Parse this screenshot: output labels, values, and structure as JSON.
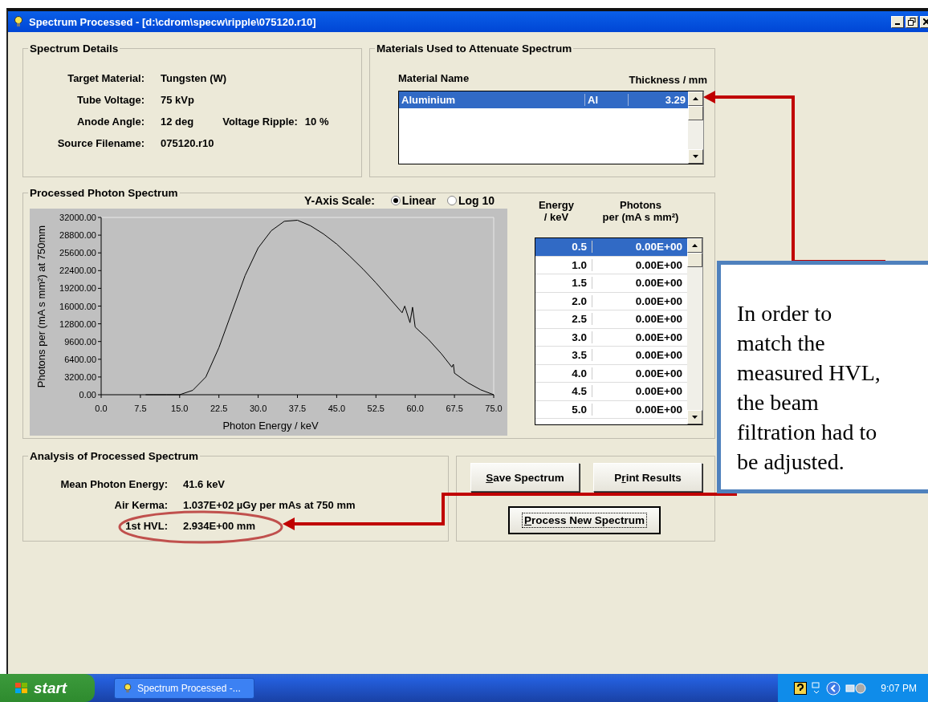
{
  "window": {
    "title": "Spectrum Processed - [d:\\cdrom\\specw\\ripple\\075120.r10]"
  },
  "spectrum_details": {
    "title": "Spectrum Details",
    "fields": [
      {
        "label": "Target Material:",
        "value": "Tungsten (W)"
      },
      {
        "label": "Tube Voltage:",
        "value": "75 kVp"
      },
      {
        "label": "Anode Angle:",
        "value": "12 deg",
        "extra_label": "Voltage Ripple:",
        "extra_value": "10 %"
      },
      {
        "label": "Source Filename:",
        "value": "075120.r10"
      }
    ]
  },
  "materials": {
    "title": "Materials Used to Attenuate Spectrum",
    "columns": [
      "Material Name",
      "Thickness / mm"
    ],
    "rows": [
      {
        "name": "Aluminium",
        "symbol": "Al",
        "thickness": "3.29",
        "selected": true
      }
    ]
  },
  "spectrum": {
    "title": "Processed Photon Spectrum",
    "scale_label": "Y-Axis Scale:",
    "scale_options": [
      {
        "label": "Linear",
        "selected": true
      },
      {
        "label": "Log 10",
        "selected": false
      }
    ],
    "chart_data": {
      "type": "line",
      "xlabel": "Photon Energy / keV",
      "ylabel": "Photons per (mA s mm²) at 750mm",
      "x": [
        8.5,
        10,
        12.5,
        15,
        17.5,
        20,
        22.5,
        25,
        27.5,
        30,
        32.5,
        35,
        37.5,
        40,
        42.5,
        45,
        47.5,
        50,
        52.5,
        55,
        57.5,
        58,
        59,
        59.5,
        60,
        62.5,
        65,
        67,
        67.3,
        67.5,
        70,
        72.5,
        75
      ],
      "series": [
        {
          "color": "#000000",
          "values": [
            0,
            0,
            0,
            0,
            800,
            3200,
            8500,
            15000,
            21500,
            26500,
            29600,
            31300,
            31500,
            30500,
            29000,
            27200,
            25000,
            22700,
            20200,
            17500,
            14800,
            16000,
            13000,
            15800,
            12200,
            10000,
            7400,
            5000,
            5500,
            3900,
            2200,
            900,
            0
          ]
        }
      ],
      "xlim": [
        0,
        75
      ],
      "ylim": [
        0,
        32000
      ],
      "xticks": [
        {
          "value": 0,
          "label": "0.0"
        },
        {
          "value": 7.5,
          "label": "7.5"
        },
        {
          "value": 15,
          "label": "15.0"
        },
        {
          "value": 22.5,
          "label": "22.5"
        },
        {
          "value": 30,
          "label": "30.0"
        },
        {
          "value": 37.5,
          "label": "37.5"
        },
        {
          "value": 45,
          "label": "45.0"
        },
        {
          "value": 52.5,
          "label": "52.5"
        },
        {
          "value": 60,
          "label": "60.0"
        },
        {
          "value": 67.5,
          "label": "67.5"
        },
        {
          "value": 75,
          "label": "75.0"
        }
      ],
      "yticks": [
        {
          "value": 0,
          "label": "0.00"
        },
        {
          "value": 3200,
          "label": "3200.00"
        },
        {
          "value": 6400,
          "label": "6400.00"
        },
        {
          "value": 9600,
          "label": "9600.00"
        },
        {
          "value": 12800,
          "label": "12800.00"
        },
        {
          "value": 16000,
          "label": "16000.00"
        },
        {
          "value": 19200,
          "label": "19200.00"
        },
        {
          "value": 22400,
          "label": "22400.00"
        },
        {
          "value": 25600,
          "label": "25600.00"
        },
        {
          "value": 28800,
          "label": "28800.00"
        },
        {
          "value": 32000,
          "label": "32000.00"
        }
      ]
    },
    "table": {
      "columns": [
        "Energy\n/ keV",
        "Photons\nper (mA s mm²)"
      ],
      "rows": [
        {
          "energy": "0.5",
          "photons": "0.00E+00",
          "selected": true
        },
        {
          "energy": "1.0",
          "photons": "0.00E+00",
          "selected": false
        },
        {
          "energy": "1.5",
          "photons": "0.00E+00",
          "selected": false
        },
        {
          "energy": "2.0",
          "photons": "0.00E+00",
          "selected": false
        },
        {
          "energy": "2.5",
          "photons": "0.00E+00",
          "selected": false
        },
        {
          "energy": "3.0",
          "photons": "0.00E+00",
          "selected": false
        },
        {
          "energy": "3.5",
          "photons": "0.00E+00",
          "selected": false
        },
        {
          "energy": "4.0",
          "photons": "0.00E+00",
          "selected": false
        },
        {
          "energy": "4.5",
          "photons": "0.00E+00",
          "selected": false
        },
        {
          "energy": "5.0",
          "photons": "0.00E+00",
          "selected": false
        }
      ]
    }
  },
  "analysis": {
    "title": "Analysis of Processed Spectrum",
    "fields": [
      {
        "label": "Mean Photon Energy:",
        "value": "41.6 keV"
      },
      {
        "label": "Air Kerma:",
        "value": "1.037E+02 µGy per mAs at 750 mm"
      },
      {
        "label": "1st HVL:",
        "value": "2.934E+00 mm"
      }
    ]
  },
  "buttons": [
    {
      "underlined": "S",
      "after": "ave Spectrum",
      "focused": false
    },
    {
      "before": "P",
      "underlined": "r",
      "after": "int Results",
      "focused": false
    },
    {
      "underlined": "P",
      "after": "rocess New Spectrum",
      "focused": true
    }
  ],
  "annotation": {
    "text": "In order to\nmatch the\nmeasured HVL,\nthe beam\nfiltration had to\nbe adjusted."
  },
  "taskbar": {
    "start": "start",
    "task": "Spectrum Processed -...",
    "clock": "9:07 PM"
  }
}
